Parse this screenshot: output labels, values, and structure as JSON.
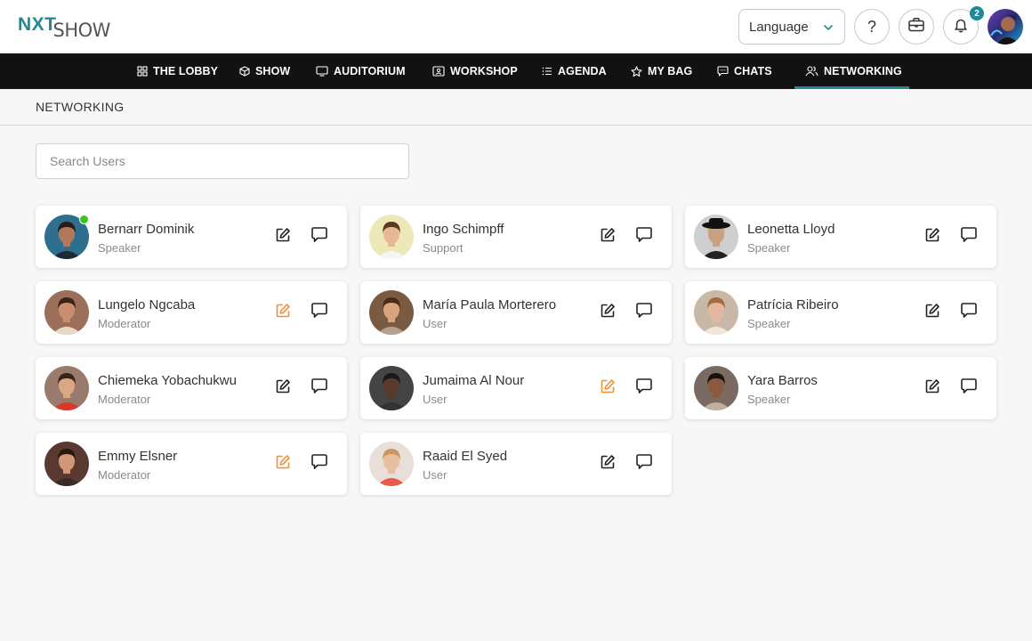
{
  "header": {
    "logo_primary": "NXT",
    "logo_secondary": "SHOW",
    "language_label": "Language",
    "help_label": "?",
    "notification_count": "2"
  },
  "nav": [
    {
      "label": "THE LOBBY",
      "icon": "grid-icon"
    },
    {
      "label": "SHOW",
      "icon": "cube-icon"
    },
    {
      "label": "AUDITORIUM",
      "icon": "monitor-icon"
    },
    {
      "label": "WORKSHOP",
      "icon": "presentation-icon"
    },
    {
      "label": "AGENDA",
      "icon": "list-icon"
    },
    {
      "label": "MY BAG",
      "icon": "star-icon"
    },
    {
      "label": "CHATS",
      "icon": "chat-bubble-icon"
    },
    {
      "label": "NETWORKING",
      "icon": "users-icon",
      "active": true
    }
  ],
  "page": {
    "title": "NETWORKING",
    "search_placeholder": "Search Users"
  },
  "colors": {
    "accent": "#1f8a96",
    "highlight_edit": "#f0913a",
    "online": "#3cc31c"
  },
  "users": [
    {
      "name": "Bernarr Dominik",
      "role": "Speaker",
      "online": true,
      "edit_highlight": false
    },
    {
      "name": "Ingo Schimpff",
      "role": "Support",
      "online": false,
      "edit_highlight": false
    },
    {
      "name": "Leonetta Lloyd",
      "role": "Speaker",
      "online": false,
      "edit_highlight": false
    },
    {
      "name": "Lungelo Ngcaba",
      "role": "Moderator",
      "online": false,
      "edit_highlight": true
    },
    {
      "name": "María Paula Morterero",
      "role": "User",
      "online": false,
      "edit_highlight": false
    },
    {
      "name": "Patrícia Ribeiro",
      "role": "Speaker",
      "online": false,
      "edit_highlight": false
    },
    {
      "name": "Chiemeka Yobachukwu",
      "role": "Moderator",
      "online": false,
      "edit_highlight": false
    },
    {
      "name": "Jumaima Al Nour",
      "role": "User",
      "online": false,
      "edit_highlight": true
    },
    {
      "name": "Yara Barros",
      "role": "Speaker",
      "online": false,
      "edit_highlight": false
    },
    {
      "name": "Emmy Elsner",
      "role": "Moderator",
      "online": false,
      "edit_highlight": true
    },
    {
      "name": "Raaid El Syed",
      "role": "User",
      "online": false,
      "edit_highlight": false
    }
  ]
}
